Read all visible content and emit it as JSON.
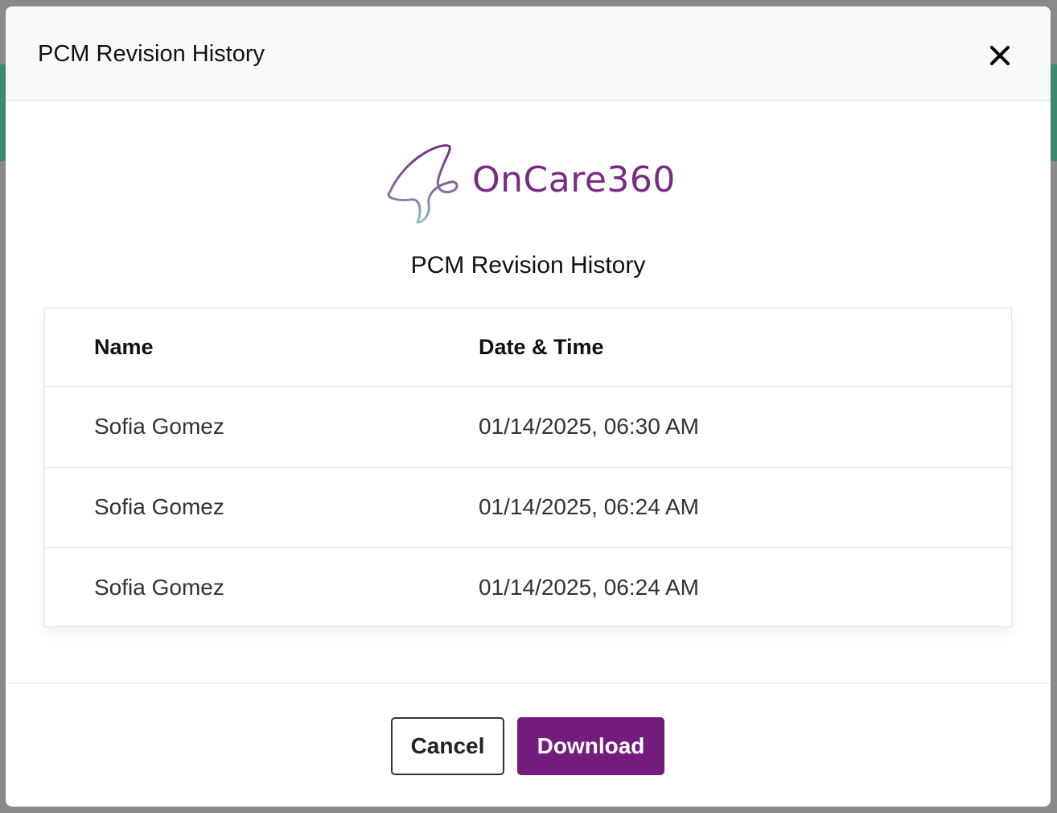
{
  "modal": {
    "header_title": "PCM Revision History",
    "close_icon": "close-icon"
  },
  "logo": {
    "text": "OnCare360",
    "icon": "oncare-ribbon-logo-icon",
    "color": "#7a2a85"
  },
  "subtitle": "PCM Revision History",
  "table": {
    "columns": [
      "Name",
      "Date & Time"
    ],
    "rows": [
      {
        "name": "Sofia Gomez",
        "datetime": "01/14/2025, 06:30 AM"
      },
      {
        "name": "Sofia Gomez",
        "datetime": "01/14/2025, 06:24 AM"
      },
      {
        "name": "Sofia Gomez",
        "datetime": "01/14/2025, 06:24 AM"
      }
    ]
  },
  "footer": {
    "cancel_label": "Cancel",
    "download_label": "Download",
    "accent_color": "#731c7e"
  }
}
